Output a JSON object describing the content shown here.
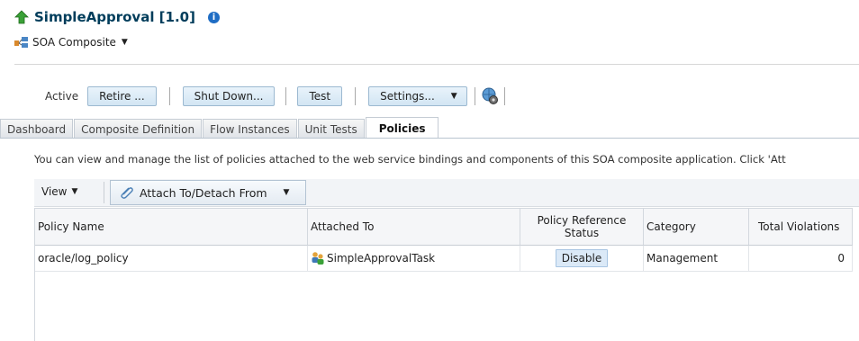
{
  "header": {
    "title": "SimpleApproval [1.0]",
    "info_icon": "i",
    "subtitle": "SOA Composite"
  },
  "toolbar": {
    "status_label": "Active",
    "retire_label": "Retire ...",
    "shutdown_label": "Shut Down...",
    "test_label": "Test",
    "settings_label": "Settings..."
  },
  "tabs": [
    {
      "label": "Dashboard"
    },
    {
      "label": "Composite Definition"
    },
    {
      "label": "Flow Instances"
    },
    {
      "label": "Unit Tests"
    },
    {
      "label": "Policies"
    }
  ],
  "active_tab": "Policies",
  "description": "You can view and manage the list of policies attached to the web service bindings and components of this SOA composite application. Click 'Att",
  "table_toolbar": {
    "view_label": "View",
    "attach_label": "Attach To/Detach From"
  },
  "table": {
    "columns": [
      "Policy Name",
      "Attached To",
      "Policy Reference Status",
      "Category",
      "Total Violations"
    ],
    "rows": [
      {
        "policy_name": "oracle/log_policy",
        "attached_to": "SimpleApprovalTask",
        "status": "Disable",
        "category": "Management",
        "violations": "0"
      }
    ]
  },
  "colors": {
    "title": "#003d5b",
    "button_bg": "#d2e5f3",
    "accent": "#1f6dc4"
  }
}
